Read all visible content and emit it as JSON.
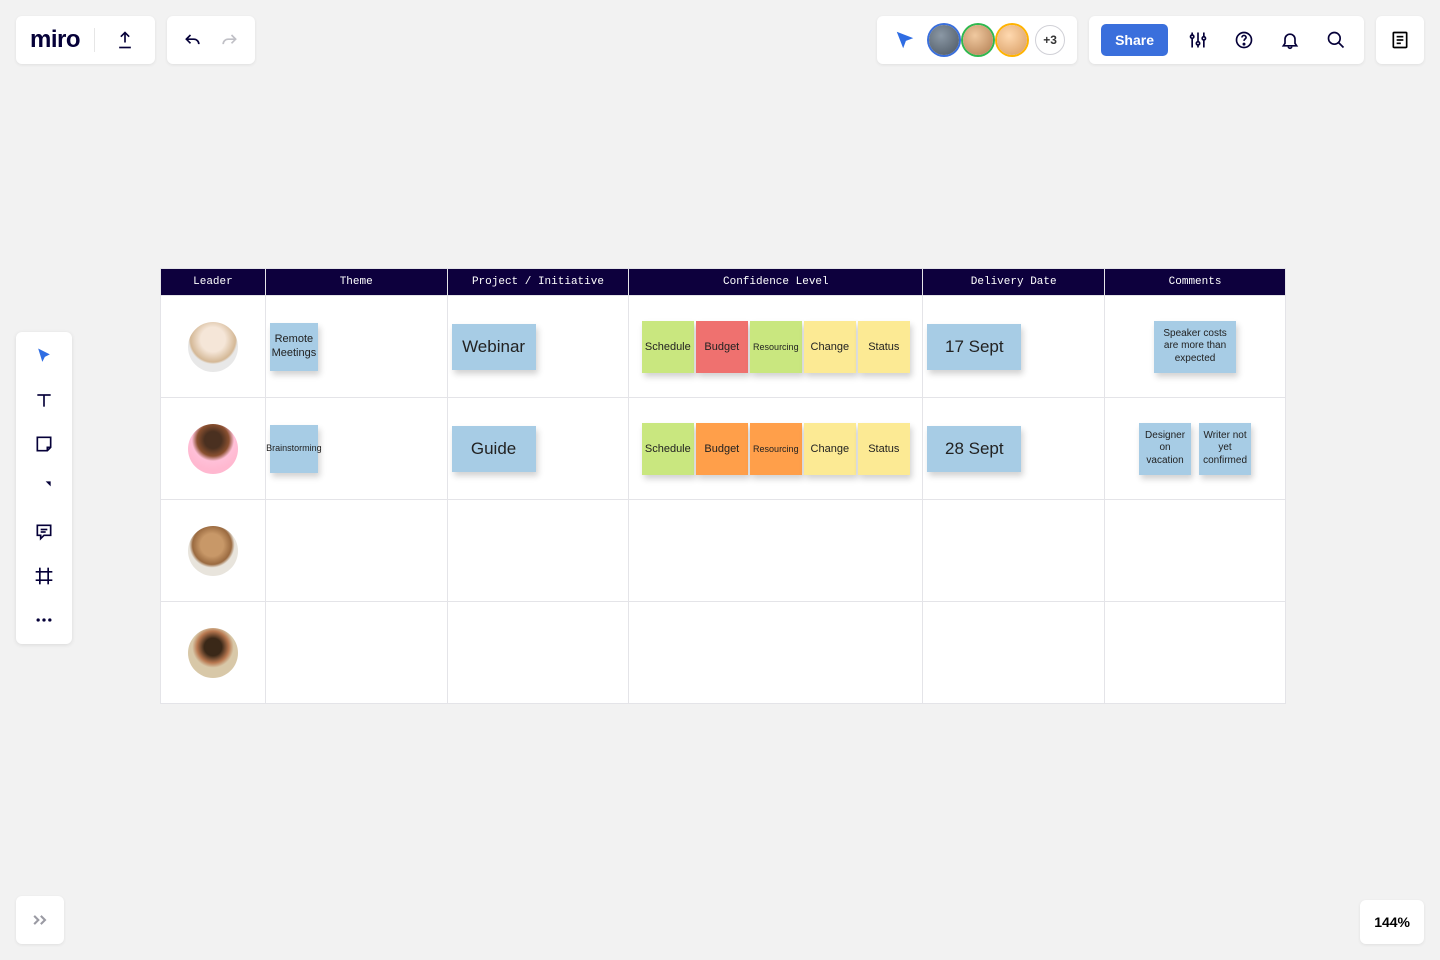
{
  "app": {
    "logo": "miro"
  },
  "collab": {
    "extra_count": "+3",
    "share_label": "Share"
  },
  "zoom": {
    "level": "144%"
  },
  "table": {
    "headers": [
      "Leader",
      "Theme",
      "Project / Initiative",
      "Confidence Level",
      "Delivery Date",
      "Comments"
    ],
    "rows": [
      {
        "theme": "Remote Meetings",
        "project": "Webinar",
        "confidence": [
          {
            "label": "Schedule",
            "color": "green"
          },
          {
            "label": "Budget",
            "color": "red"
          },
          {
            "label": "Resourcing",
            "color": "green"
          },
          {
            "label": "Change",
            "color": "yellow"
          },
          {
            "label": "Status",
            "color": "yellow"
          }
        ],
        "delivery": "17 Sept",
        "comments": [
          {
            "label": "Speaker costs are more than expected"
          }
        ]
      },
      {
        "theme": "Brainstorming",
        "project": "Guide",
        "confidence": [
          {
            "label": "Schedule",
            "color": "green"
          },
          {
            "label": "Budget",
            "color": "orange"
          },
          {
            "label": "Resourcing",
            "color": "orange"
          },
          {
            "label": "Change",
            "color": "yellow"
          },
          {
            "label": "Status",
            "color": "yellow"
          }
        ],
        "delivery": "28 Sept",
        "comments": [
          {
            "label": "Designer on vacation"
          },
          {
            "label": "Writer not yet confirmed"
          }
        ]
      },
      {
        "theme": "",
        "project": "",
        "confidence": [],
        "delivery": "",
        "comments": []
      },
      {
        "theme": "",
        "project": "",
        "confidence": [],
        "delivery": "",
        "comments": []
      }
    ]
  }
}
